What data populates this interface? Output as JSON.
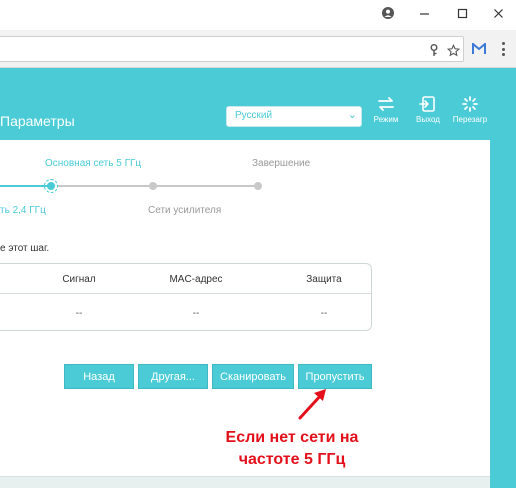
{
  "window": {
    "controls": {
      "account_glyph": "●",
      "minimize_glyph": "—",
      "maximize_glyph": "☐",
      "close_glyph": "✕"
    }
  },
  "browser": {
    "icons": [
      "account-icon",
      "minimize-icon",
      "maximize-icon",
      "close-icon",
      "key-icon",
      "star-icon",
      "gmail-extension-icon",
      "menu-icon"
    ]
  },
  "header": {
    "title": "Параметры",
    "language": {
      "selected": "Русский"
    },
    "buttons": {
      "mode": "Режим",
      "logout": "Выход",
      "reboot": "Перезагр"
    }
  },
  "stepper": {
    "step_main_5ghz": "Основная сеть 5 ГГц",
    "step_finish": "Завершение",
    "step_main_24ghz": "ть 2,4 ГГц",
    "step_extender": "Сети усилителя",
    "accent": "#4acbd6",
    "inactive": "#c8c8c8"
  },
  "instruction": "е этот шаг.",
  "table": {
    "headers": [
      "Сигнал",
      "MAC-адрес",
      "Защита"
    ],
    "row": [
      "--",
      "--",
      "--"
    ]
  },
  "actions": {
    "back": "Назад",
    "other": "Другая...",
    "scan": "Сканировать",
    "skip": "Пропустить"
  },
  "annotation": {
    "line1": "Если нет сети на",
    "line2": "частоте 5 ГГц",
    "color": "#e3101b"
  }
}
